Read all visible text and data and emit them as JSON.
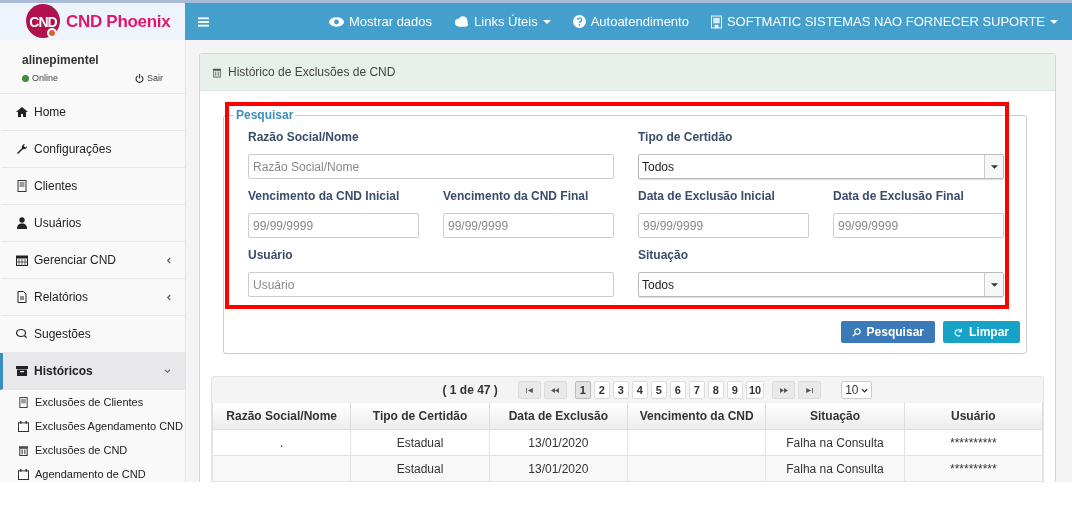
{
  "app": {
    "logo": "CND",
    "name": "CND Phoenix"
  },
  "navbar": {
    "items": [
      {
        "label": "Mostrar dados",
        "dropdown": false
      },
      {
        "label": "Links Úteis",
        "dropdown": true
      },
      {
        "label": "Autoatendimento",
        "dropdown": false
      },
      {
        "label": "SOFTMATIC SISTEMAS NAO FORNECER SUPORTE",
        "dropdown": true
      }
    ]
  },
  "user": {
    "name": "alinepimentel",
    "status": "Online",
    "logout": "Sair"
  },
  "sidebar": {
    "items": [
      {
        "label": "Home",
        "kind": "link",
        "selected": false
      },
      {
        "label": "Configurações",
        "kind": "link",
        "selected": false
      },
      {
        "label": "Clientes",
        "kind": "link",
        "selected": false
      },
      {
        "label": "Usuários",
        "kind": "link",
        "selected": false
      },
      {
        "label": "Gerenciar CND",
        "kind": "menu",
        "expanded": false,
        "selected": false
      },
      {
        "label": "Relatórios",
        "kind": "menu",
        "expanded": false,
        "selected": false
      },
      {
        "label": "Sugestões",
        "kind": "link",
        "selected": false
      },
      {
        "label": "Históricos",
        "kind": "menu",
        "expanded": true,
        "selected": true,
        "children": [
          {
            "label": "Exclusões de Clientes"
          },
          {
            "label": "Exclusões Agendamento CND"
          },
          {
            "label": "Exclusões de CND"
          },
          {
            "label": "Agendamento de CND"
          }
        ]
      }
    ]
  },
  "panel": {
    "title": "Histórico de Exclusões de CND"
  },
  "search": {
    "legend": "Pesquisar",
    "rows": [
      [
        {
          "label": "Razão Social/Nome",
          "kind": "text",
          "placeholder": "Razão Social/Nome"
        },
        {
          "label": "Tipo de Certidão",
          "kind": "select",
          "value": "Todos"
        }
      ],
      [
        {
          "label": "Vencimento da CND Inicial",
          "kind": "text",
          "placeholder": "99/99/9999"
        },
        {
          "label": "Vencimento da CND Final",
          "kind": "text",
          "placeholder": "99/99/9999"
        },
        {
          "label": "Data de Exclusão Inicial",
          "kind": "text",
          "placeholder": "99/99/9999"
        },
        {
          "label": "Data de Exclusão Final",
          "kind": "text",
          "placeholder": "99/99/9999"
        }
      ],
      [
        {
          "label": "Usuário",
          "kind": "text",
          "placeholder": "Usuário"
        },
        {
          "label": "Situação",
          "kind": "select",
          "value": "Todos"
        }
      ]
    ],
    "buttons": [
      {
        "label": "Pesquisar",
        "kind": "primary"
      },
      {
        "label": "Limpar",
        "kind": "info"
      }
    ]
  },
  "table": {
    "pager": {
      "summary": "( 1 de 47 )",
      "page_size": "10",
      "pages": [
        {
          "label": "1",
          "selected": true
        },
        {
          "label": "2",
          "selected": false
        },
        {
          "label": "3",
          "selected": false
        },
        {
          "label": "4",
          "selected": false
        },
        {
          "label": "5",
          "selected": false
        },
        {
          "label": "6",
          "selected": false
        },
        {
          "label": "7",
          "selected": false
        },
        {
          "label": "8",
          "selected": false
        },
        {
          "label": "9",
          "selected": false
        },
        {
          "label": "10",
          "selected": false
        }
      ]
    },
    "columns": [
      "Razão Social/Nome",
      "Tipo de Certidão",
      "Data de Exclusão",
      "Vencimento da CND",
      "Situação",
      "Usuário"
    ],
    "rows": [
      [
        ".",
        "Estadual",
        "13/01/2020",
        "",
        "Falha na Consulta",
        "**********"
      ],
      [
        "",
        "Estadual",
        "13/01/2020",
        "",
        "Falha na Consulta",
        "**********"
      ]
    ]
  }
}
